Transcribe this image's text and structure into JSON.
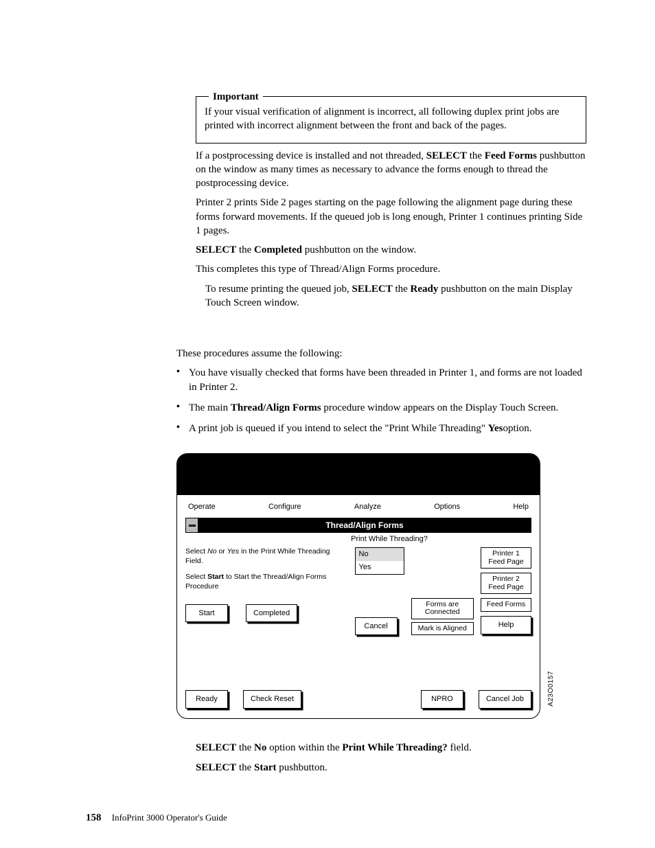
{
  "important": {
    "legend": "Important",
    "body": "If your visual verification of alignment is incorrect, all following duplex print jobs are printed with incorrect alignment between the front and back of the pages."
  },
  "p_postproc_a": "If a postprocessing device is installed and not threaded, ",
  "p_postproc_b": "SELECT",
  "p_postproc_c": " the ",
  "p_postproc_d": "Feed Forms",
  "p_postproc_e": " pushbutton on the window as many times as necessary to advance the forms enough to thread the postprocessing device.",
  "p_printer2": "Printer 2 prints Side 2 pages starting on the page following the alignment page during these forms forward movements. If the queued job is long enough, Printer 1 continues printing Side 1 pages.",
  "p_sel_comp_a": "SELECT",
  "p_sel_comp_b": " the ",
  "p_sel_comp_c": "Completed",
  "p_sel_comp_d": " pushbutton on the window.",
  "p_complete": "This completes this type of Thread/Align Forms procedure.",
  "p_resume_a": "To resume printing the queued job, ",
  "p_resume_b": "SELECT",
  "p_resume_c": " the ",
  "p_resume_d": "Ready",
  "p_resume_e": " pushbutton on the main Display Touch Screen window.",
  "assume_intro": "These procedures assume the following:",
  "bullets": {
    "b1": "You have visually checked that forms have been threaded in Printer 1, and forms are not loaded in Printer 2.",
    "b2_a": "The main ",
    "b2_b": "Thread/Align Forms",
    "b2_c": " procedure window appears on the Display Touch Screen.",
    "b3_a": "A print job is queued if you intend to select the \"Print While Threading\" ",
    "b3_b": "Yes",
    "b3_c": "option."
  },
  "screen": {
    "menu": {
      "operate": "Operate",
      "configure": "Configure",
      "analyze": "Analyze",
      "options": "Options",
      "help": "Help"
    },
    "title": "Thread/Align Forms",
    "field_legend": "Print While Threading?",
    "instr1_a": "Select ",
    "instr1_no": "No",
    "instr1_b": " or ",
    "instr1_yes": "Yes",
    "instr1_c": " in the Print While Threading Field.",
    "instr2_a": "Select ",
    "instr2_start": "Start",
    "instr2_b": " to Start the Thread/Align Forms Procedure",
    "listbox": {
      "no": "No",
      "yes": "Yes"
    },
    "status": {
      "forms": "Forms are Connected",
      "mark": "Mark is Aligned"
    },
    "right_btns": {
      "p1": "Printer 1 Feed Page",
      "p2": "Printer 2 Feed Page",
      "ff": "Feed Forms",
      "help": "Help"
    },
    "row_btns": {
      "start": "Start",
      "completed": "Completed",
      "cancel": "Cancel"
    },
    "bottom": {
      "ready": "Ready",
      "check": "Check Reset",
      "npro": "NPRO",
      "cancel": "Cancel Job"
    },
    "figref": "A23O0157"
  },
  "after1_a": "SELECT",
  "after1_b": " the ",
  "after1_c": "No",
  "after1_d": " option within the ",
  "after1_e": "Print While Threading?",
  "after1_f": " field.",
  "after2_a": "SELECT",
  "after2_b": " the ",
  "after2_c": "Start",
  "after2_d": " pushbutton.",
  "footer": {
    "page": "158",
    "book": "InfoPrint 3000 Operator's Guide"
  }
}
